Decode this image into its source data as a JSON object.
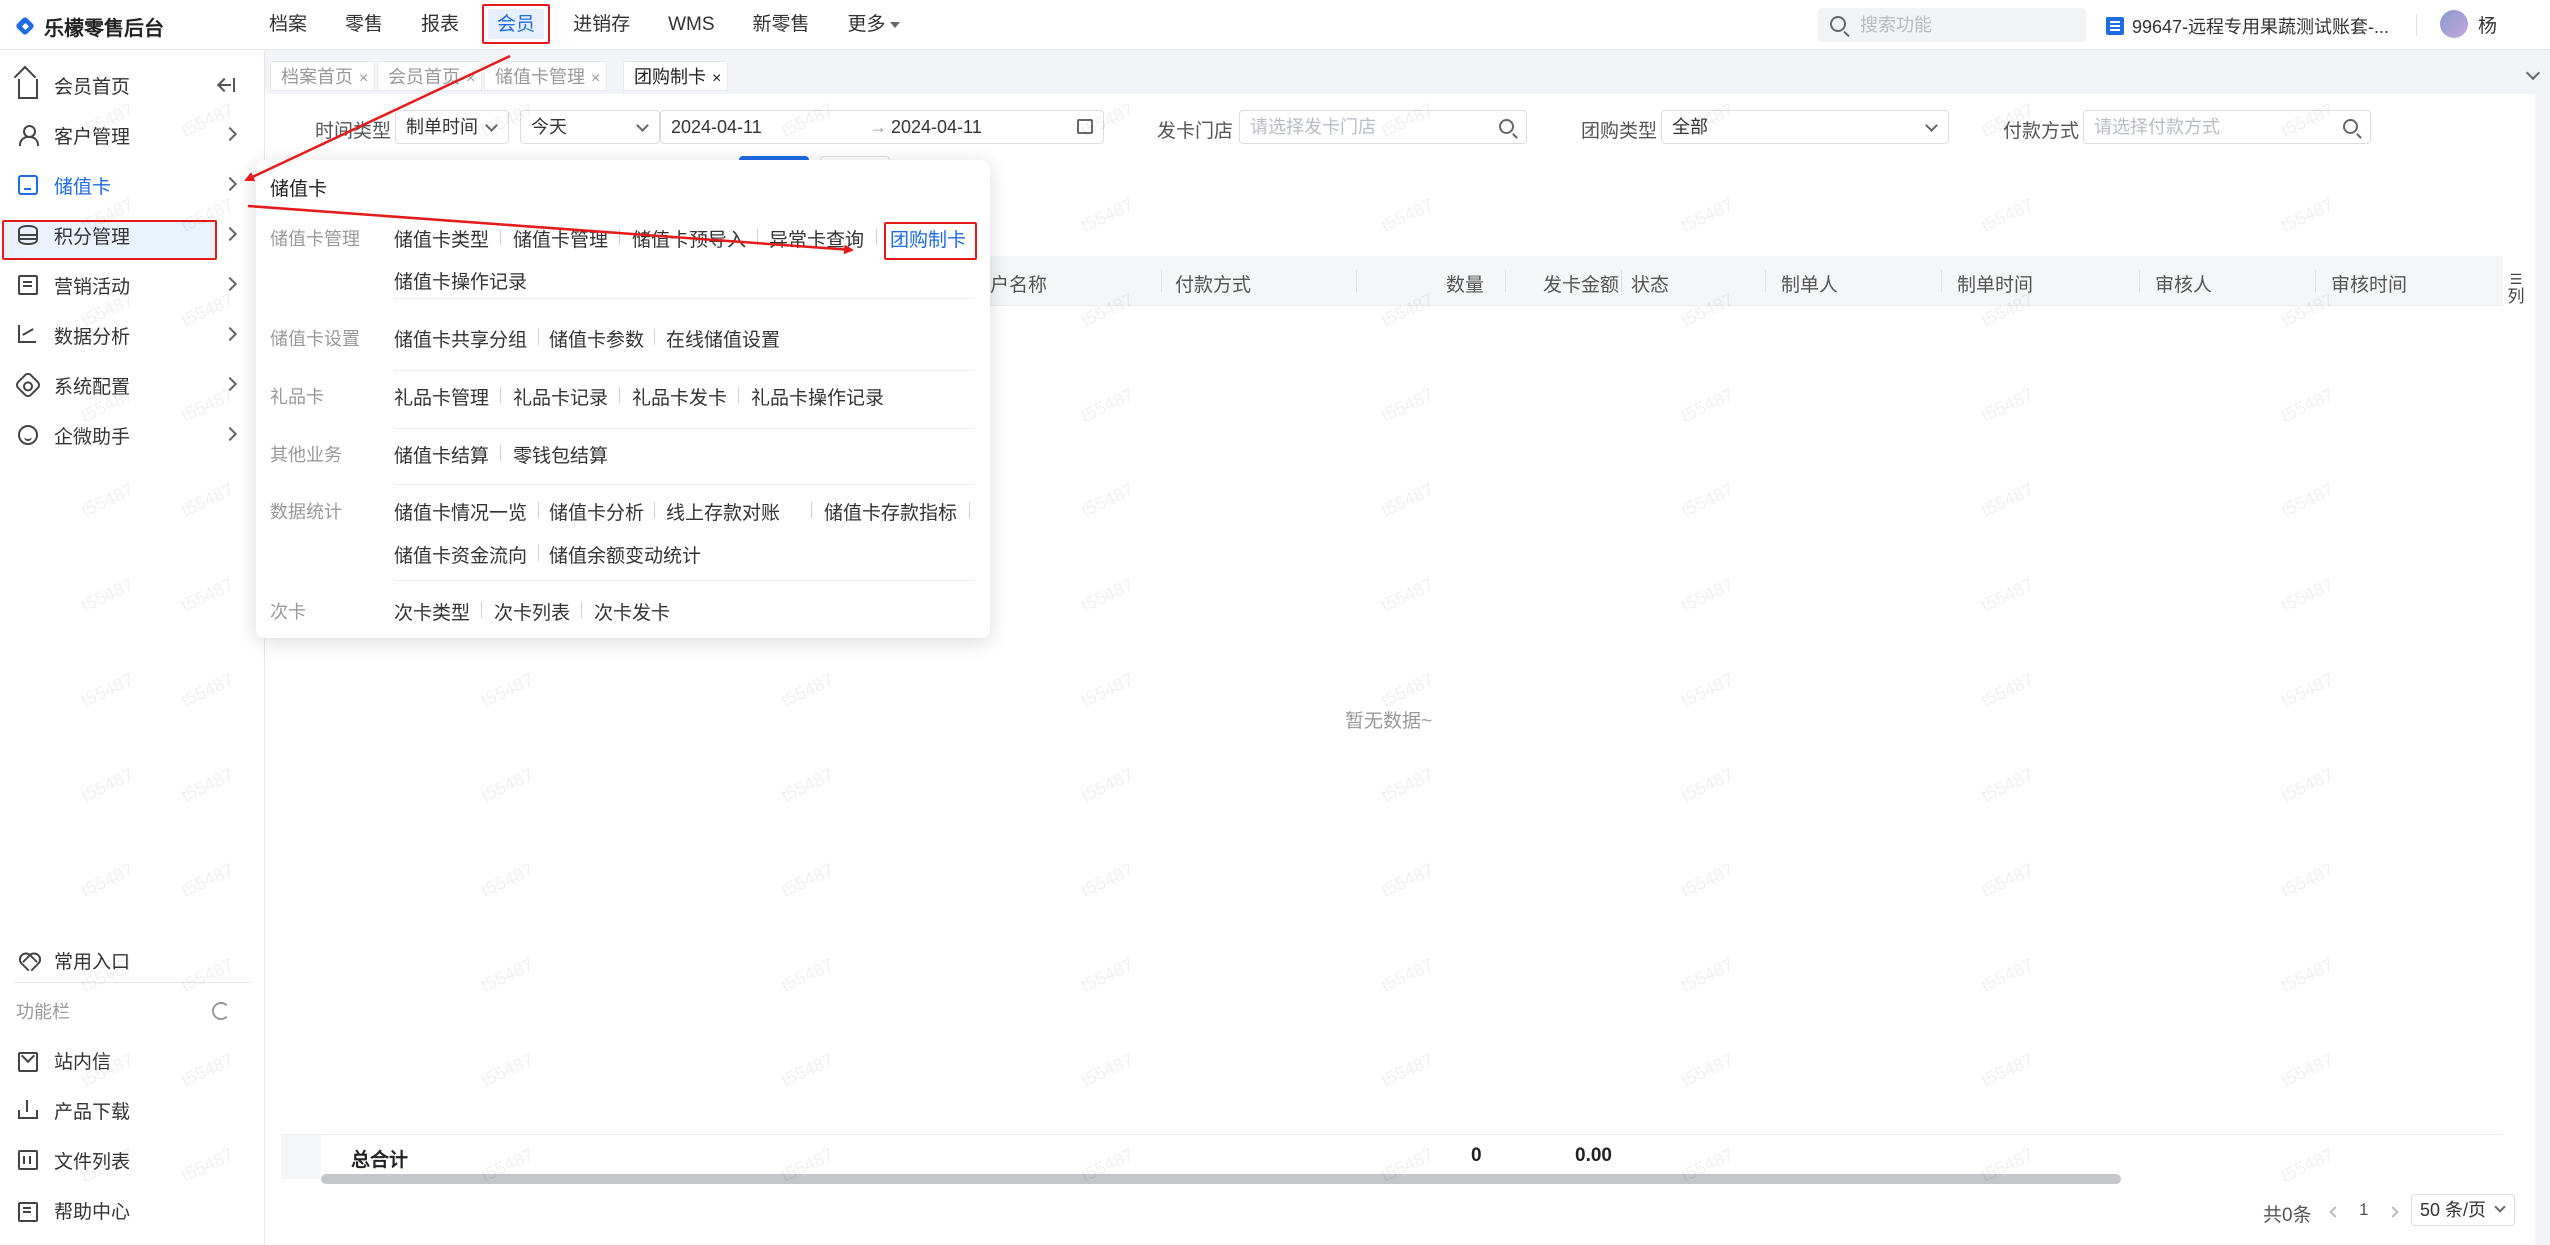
{
  "app": {
    "title": "乐檬零售后台"
  },
  "topnav": {
    "items": [
      "档案",
      "零售",
      "报表",
      "会员",
      "进销存",
      "WMS",
      "新零售",
      "更多"
    ],
    "active": "会员"
  },
  "search": {
    "placeholder": "搜索功能"
  },
  "store": {
    "name": "99647-远程专用果蔬测试账套-..."
  },
  "user": {
    "name": "杨"
  },
  "sidebar": {
    "items": [
      "会员首页",
      "客户管理",
      "储值卡",
      "积分管理",
      "营销活动",
      "数据分析",
      "系统配置",
      "企微助手"
    ],
    "selected": "储值卡",
    "favorites": "常用入口",
    "section": "功能栏",
    "tools": [
      "站内信",
      "产品下载",
      "文件列表",
      "帮助中心"
    ]
  },
  "tabs": [
    "档案首页",
    "会员首页",
    "储值卡管理",
    "团购制卡"
  ],
  "filters": {
    "time_type_label": "时间类型",
    "time_type_value": "制单时间",
    "period_value": "今天",
    "date_start": "2024-04-11",
    "date_end": "2024-04-11",
    "store_label": "发卡门店",
    "store_placeholder": "请选择发卡门店",
    "group_type_label": "团购类型",
    "group_type_value": "全部",
    "pay_label": "付款方式",
    "pay_placeholder": "请选择付款方式"
  },
  "table": {
    "columns": [
      "客户名称",
      "付款方式",
      "数量",
      "发卡金额",
      "状态",
      "制单人",
      "制单时间",
      "审核人",
      "审核时间"
    ],
    "empty_text": "暂无数据~",
    "column_setting": "列",
    "total_label": "总合计",
    "total_quantity": "0",
    "total_amount": "0.00"
  },
  "pagination": {
    "total": "共0条",
    "page": "1",
    "page_size": "50 条/页"
  },
  "flyout": {
    "title": "储值卡",
    "groups": [
      {
        "category": "储值卡管理",
        "links": [
          "储值卡类型",
          "储值卡管理",
          "储值卡预导入",
          "异常卡查询",
          "团购制卡",
          "储值卡操作记录"
        ]
      },
      {
        "category": "储值卡设置",
        "links": [
          "储值卡共享分组",
          "储值卡参数",
          "在线储值设置"
        ]
      },
      {
        "category": "礼品卡",
        "links": [
          "礼品卡管理",
          "礼品卡记录",
          "礼品卡发卡",
          "礼品卡操作记录"
        ]
      },
      {
        "category": "其他业务",
        "links": [
          "储值卡结算",
          "零钱包结算"
        ]
      },
      {
        "category": "数据统计",
        "links": [
          "储值卡情况一览",
          "储值卡分析",
          "线上存款对账",
          "储值卡存款指标",
          "储值卡资金流向",
          "储值余额变动统计"
        ]
      },
      {
        "category": "次卡",
        "links": [
          "次卡类型",
          "次卡列表",
          "次卡发卡"
        ]
      }
    ],
    "highlighted": "团购制卡"
  },
  "watermark": "t55487",
  "colors": {
    "accent": "#1e6be6",
    "annotation": "#e51b1b"
  }
}
